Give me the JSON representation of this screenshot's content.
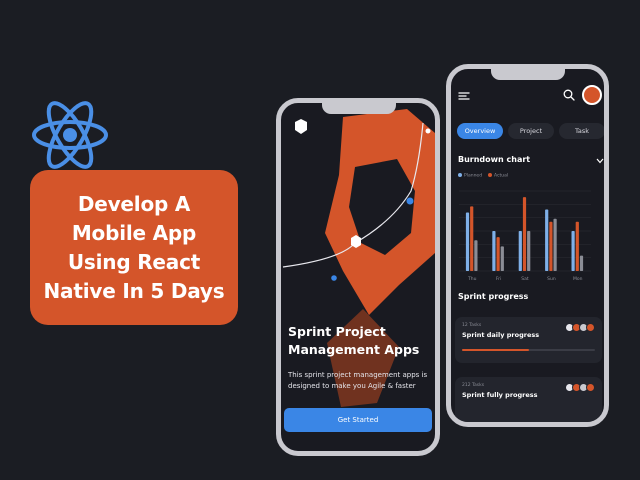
{
  "promo": {
    "headline": "Develop A Mobile App Using React Native In 5 Days"
  },
  "onboarding": {
    "title": "Sprint Project Management Apps",
    "description": "This sprint project management apps is designed to make you Agile & faster",
    "cta_label": "Get Started"
  },
  "dashboard": {
    "tabs": [
      {
        "label": "Overview",
        "active": true
      },
      {
        "label": "Project",
        "active": false
      },
      {
        "label": "Task",
        "active": false
      }
    ],
    "burndown_title": "Burndown chart",
    "legend": [
      {
        "label": "Planned",
        "color": "#7fb0e8"
      },
      {
        "label": "Actual",
        "color": "#d4552a"
      }
    ],
    "sprint_progress_title": "Sprint progress",
    "cards": [
      {
        "small": "12 Tasks",
        "title": "Sprint daily progress",
        "progress": 0.5
      },
      {
        "small": "212 Tasks",
        "title": "Sprint fully progress",
        "progress": 0.0
      }
    ]
  },
  "chart_data": {
    "type": "bar",
    "categories": [
      "Thu",
      "Fri",
      "Sat",
      "Sun",
      "Mon"
    ],
    "series": [
      {
        "name": "Planned",
        "values": [
          1.9,
          1.3,
          1.3,
          2.0,
          1.3
        ]
      },
      {
        "name": "Actual",
        "values": [
          2.1,
          1.1,
          2.4,
          1.6,
          1.6
        ]
      },
      {
        "name": "",
        "values": [
          1.0,
          0.8,
          1.3,
          1.7,
          0.5
        ]
      }
    ],
    "ylabel": "",
    "ylim": [
      0,
      2.6
    ]
  },
  "colors": {
    "accent": "#d4552a",
    "primary_blue": "#3a86e6",
    "background": "#1b1d23"
  }
}
